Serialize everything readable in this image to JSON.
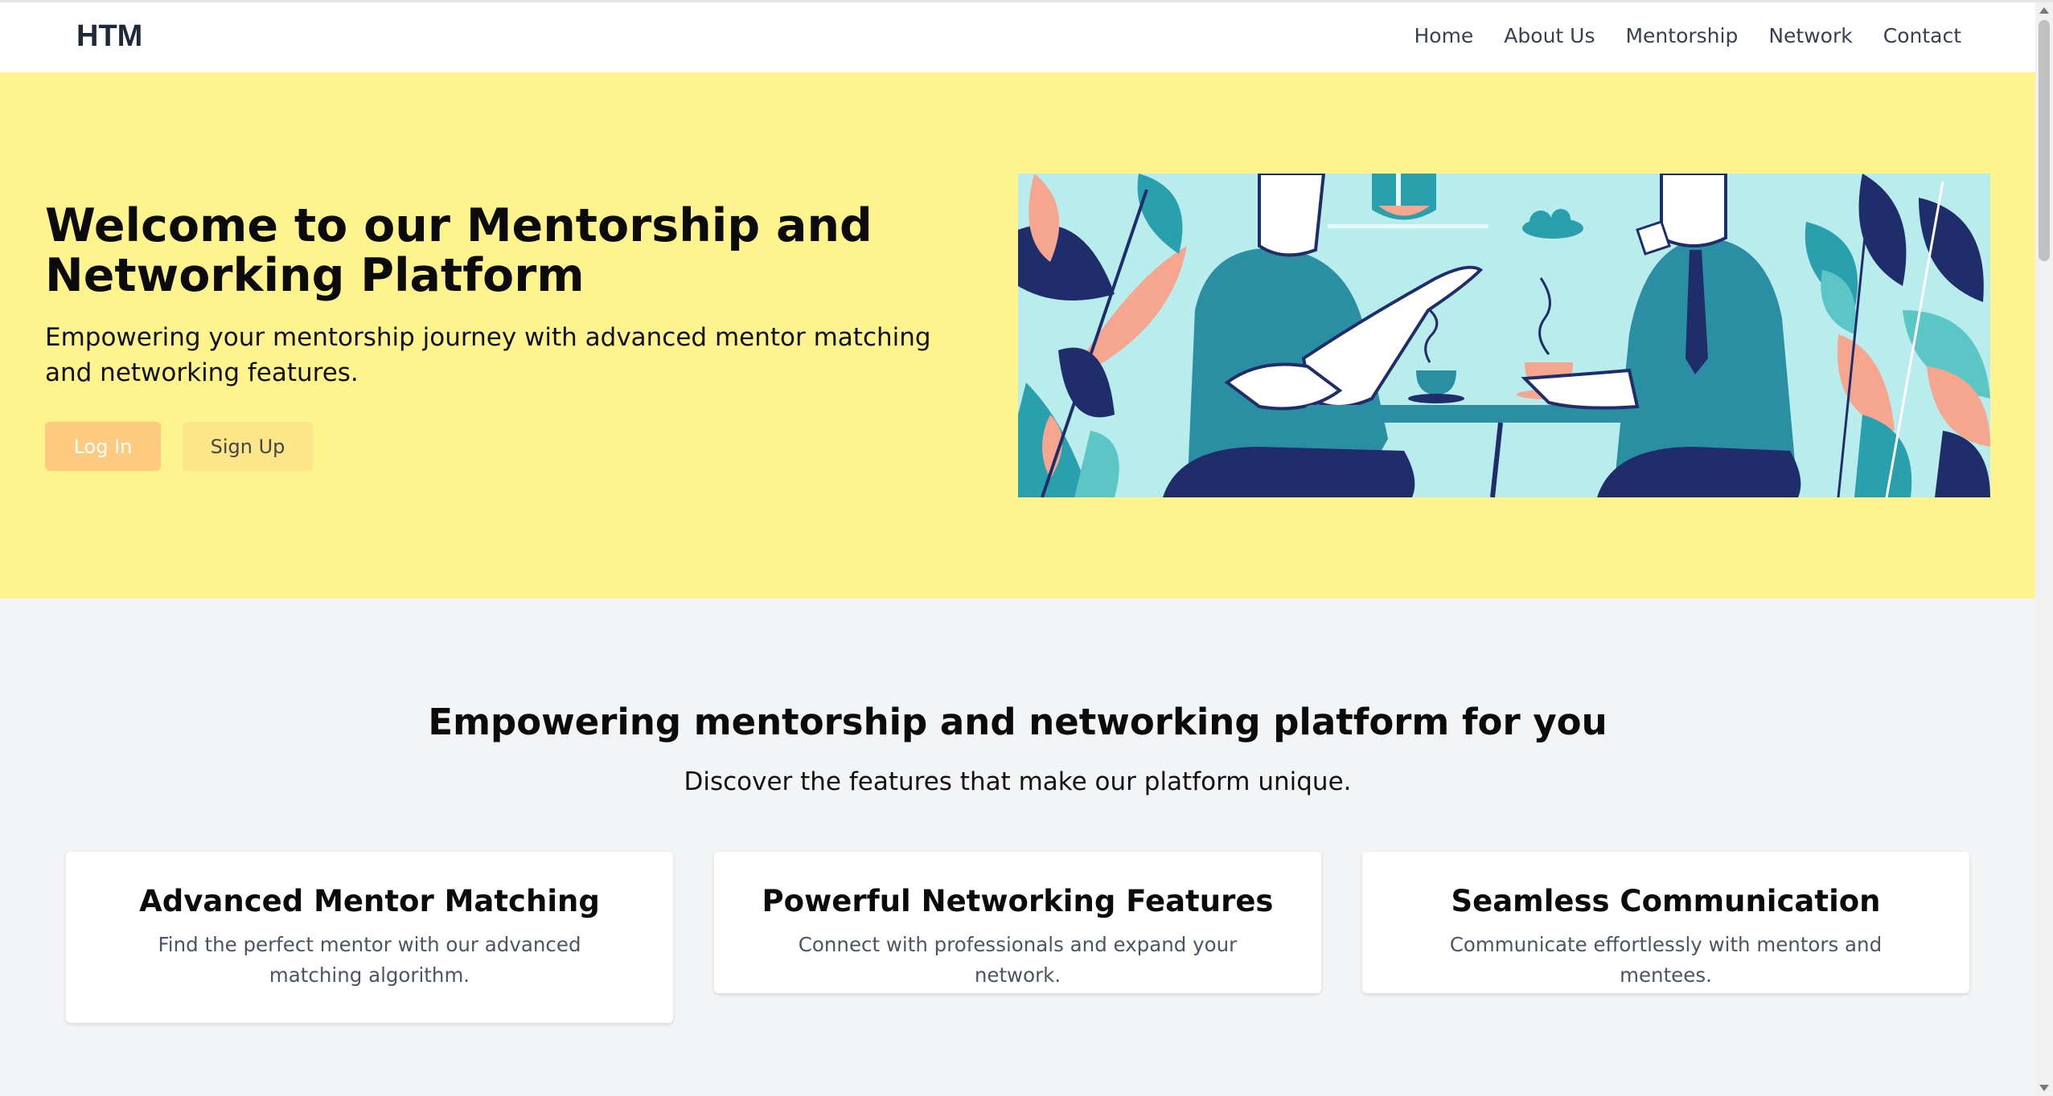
{
  "brand": {
    "logo_text": "HTM"
  },
  "nav": {
    "items": [
      "Home",
      "About Us",
      "Mentorship",
      "Network",
      "Contact"
    ]
  },
  "hero": {
    "title": "Welcome to our Mentorship and Networking Platform",
    "subtitle": "Empowering your mentorship journey with advanced mentor matching and networking features.",
    "login_label": "Log In",
    "signup_label": "Sign Up",
    "background_color": "#fef38c",
    "image": "illustration of two people talking over coffee at a table with plants"
  },
  "features": {
    "title": "Empowering mentorship and networking platform for you",
    "subtitle": "Discover the features that make our platform unique.",
    "cards": [
      {
        "title": "Advanced Mentor Matching",
        "text": "Find the perfect mentor with our advanced matching algorithm."
      },
      {
        "title": "Powerful Networking Features",
        "text": "Connect with professionals and expand your network."
      },
      {
        "title": "Seamless Communication",
        "text": "Communicate effortlessly with mentors and mentees."
      }
    ]
  },
  "colors": {
    "login_button": "#fdca7f",
    "signup_button": "#fde68a",
    "page_background": "#f3f4f6"
  }
}
